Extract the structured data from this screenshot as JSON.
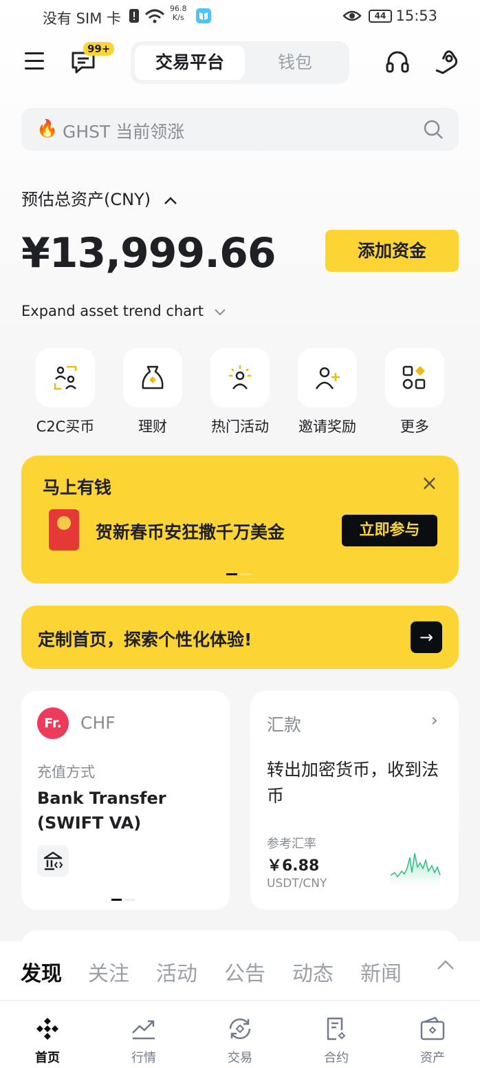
{
  "status_bar": {
    "carrier": "没有 SIM 卡",
    "speed_value": "96.8",
    "speed_unit": "K/s",
    "battery": "44",
    "time": "15:53"
  },
  "header": {
    "badge": "99+",
    "tab_active": "交易平台",
    "tab_inactive": "钱包"
  },
  "search": {
    "placeholder": "GHST 当前领涨"
  },
  "assets": {
    "label": "预估总资产(CNY)",
    "value": "¥13,999.66",
    "add_button": "添加资金",
    "expand_text": "Expand asset trend chart"
  },
  "quick_actions": [
    {
      "label": "C2C买币",
      "icon": "c2c-icon"
    },
    {
      "label": "理财",
      "icon": "money-bag-icon"
    },
    {
      "label": "热门活动",
      "icon": "activity-icon"
    },
    {
      "label": "邀请奖励",
      "icon": "invite-icon"
    },
    {
      "label": "更多",
      "icon": "more-grid-icon"
    }
  ],
  "banner": {
    "title": "马上有钱",
    "text": "贺新春币安狂撒千万美金",
    "button": "立即参与"
  },
  "customize": {
    "text": "定制首页，探索个性化体验!"
  },
  "deposit_card": {
    "currency_logo": "Fr.",
    "currency": "CHF",
    "method_label": "充值方式",
    "method_value": "Bank Transfer (SWIFT VA)"
  },
  "remit_card": {
    "title": "汇款",
    "description": "转出加密货币，收到法币",
    "rate_label": "参考汇率",
    "rate_value": "￥6.88",
    "pair": "USDT/CNY"
  },
  "discover_tabs": [
    "发现",
    "关注",
    "活动",
    "公告",
    "动态",
    "新闻"
  ],
  "bottom_nav": [
    {
      "label": "首页",
      "icon": "home-logo-icon"
    },
    {
      "label": "行情",
      "icon": "markets-icon"
    },
    {
      "label": "交易",
      "icon": "trade-icon"
    },
    {
      "label": "合约",
      "icon": "futures-icon"
    },
    {
      "label": "资产",
      "icon": "wallet-icon"
    }
  ],
  "colors": {
    "accent": "#fcd535",
    "text_primary": "#1e2026",
    "text_secondary": "#868b94",
    "chf_logo": "#ef3b5b",
    "sparkline": "#2ebd85"
  }
}
